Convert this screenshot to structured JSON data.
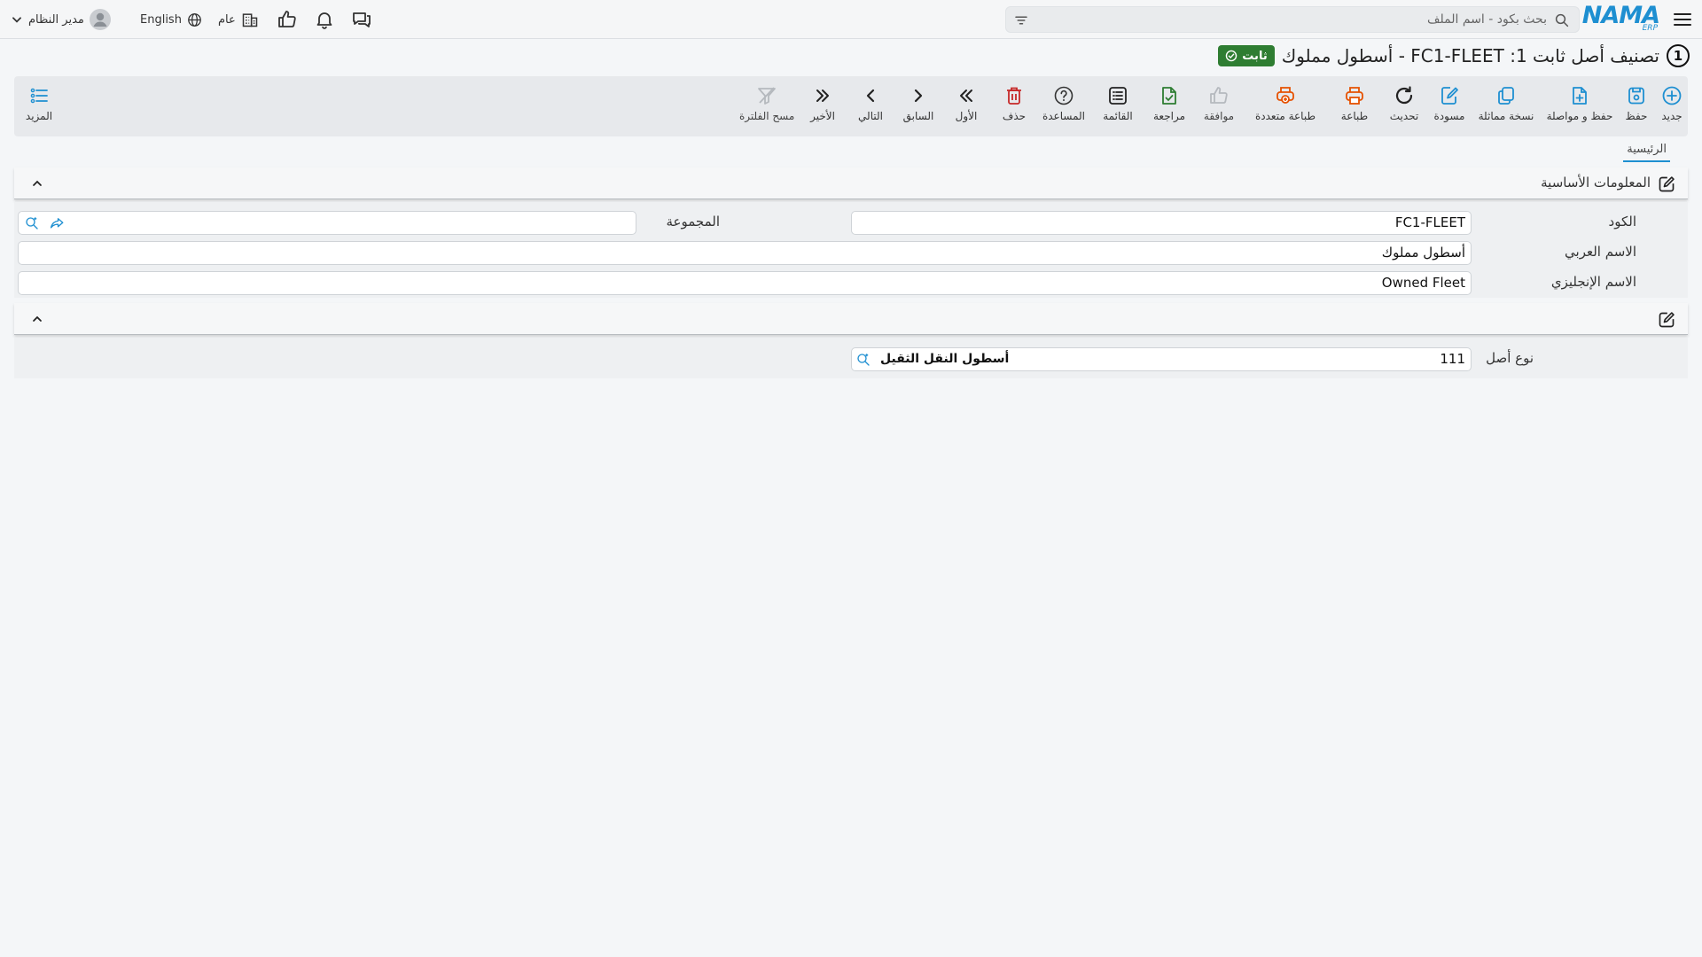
{
  "app": {
    "brand": "NAMA",
    "brand_sub": "ERP"
  },
  "topbar": {
    "search_placeholder": "بحث بكود - اسم الملف",
    "company_label": "عام",
    "language_label": "English",
    "user_label": "مدير النظام"
  },
  "page": {
    "number": "1",
    "title": "تصنيف أصل ثابت 1: FC1-FLEET - أسطول مملوك",
    "status": "ثابت"
  },
  "toolbar": {
    "new": "جديد",
    "save": "حفظ",
    "save_continue": "حفظ و مواصلة",
    "duplicate": "نسخة مماثلة",
    "draft": "مسودة",
    "refresh": "تحديث",
    "print": "طباعة",
    "multi_print": "طباعة متعددة",
    "approve": "موافقة",
    "review": "مراجعة",
    "list": "القائمة",
    "help": "المساعدة",
    "delete": "حذف",
    "first": "الأول",
    "previous": "السابق",
    "next": "التالي",
    "last": "الأخير",
    "clear_filter": "مسح الفلترة",
    "more": "المزيد"
  },
  "tabs": {
    "main": "الرئيسية"
  },
  "basic_info": {
    "title": "المعلومات الأساسية",
    "code_label": "الكود",
    "code_value": "FC1-FLEET",
    "group_label": "المجموعة",
    "group_value": "",
    "arabic_name_label": "الاسم العربي",
    "arabic_name_value": "أسطول مملوك",
    "english_name_label": "الاسم الإنجليزي",
    "english_name_value": "Owned Fleet"
  },
  "second_section": {
    "asset_type_label": "نوع أصل",
    "asset_type_code": "111",
    "asset_type_name": "أسطول النقل الثقيل"
  },
  "colors": {
    "brand": "#1e8fd1",
    "status_green": "#2e7d32",
    "delete_red": "#c62828",
    "print_orange": "#e65100"
  }
}
